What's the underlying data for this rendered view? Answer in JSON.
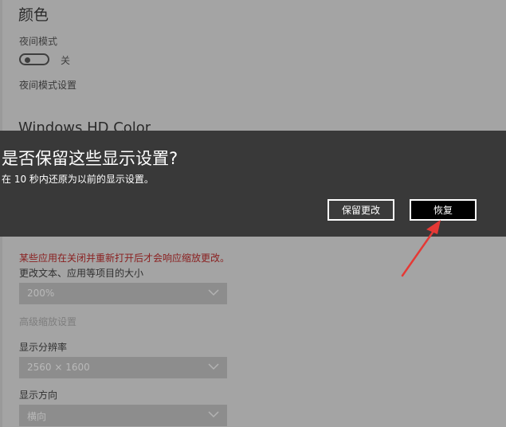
{
  "settings": {
    "section_title": "颜色",
    "night_mode_label": "夜间模式",
    "night_mode_state": "关",
    "night_mode_settings_link": "夜间模式设置",
    "hd_color_title": "Windows HD Color",
    "warning_text": "某些应用在关闭并重新打开后才会响应缩放更改。",
    "scale_label": "更改文本、应用等项目的大小",
    "scale_value": "200%",
    "advanced_scaling_link": "高级缩放设置",
    "resolution_label": "显示分辨率",
    "resolution_value": "2560 × 1600",
    "orientation_label": "显示方向",
    "orientation_value": "横向"
  },
  "dialog": {
    "title": "是否保留这些显示设置?",
    "message": "在 10 秒内还原为以前的显示设置。",
    "keep_label": "保留更改",
    "revert_label": "恢复"
  },
  "annotation": {
    "arrow_color": "#e53935"
  },
  "colors": {
    "dimmed_background": "#a4a4a4",
    "dialog_background": "#393939",
    "warning_text": "#8a1f1f"
  }
}
